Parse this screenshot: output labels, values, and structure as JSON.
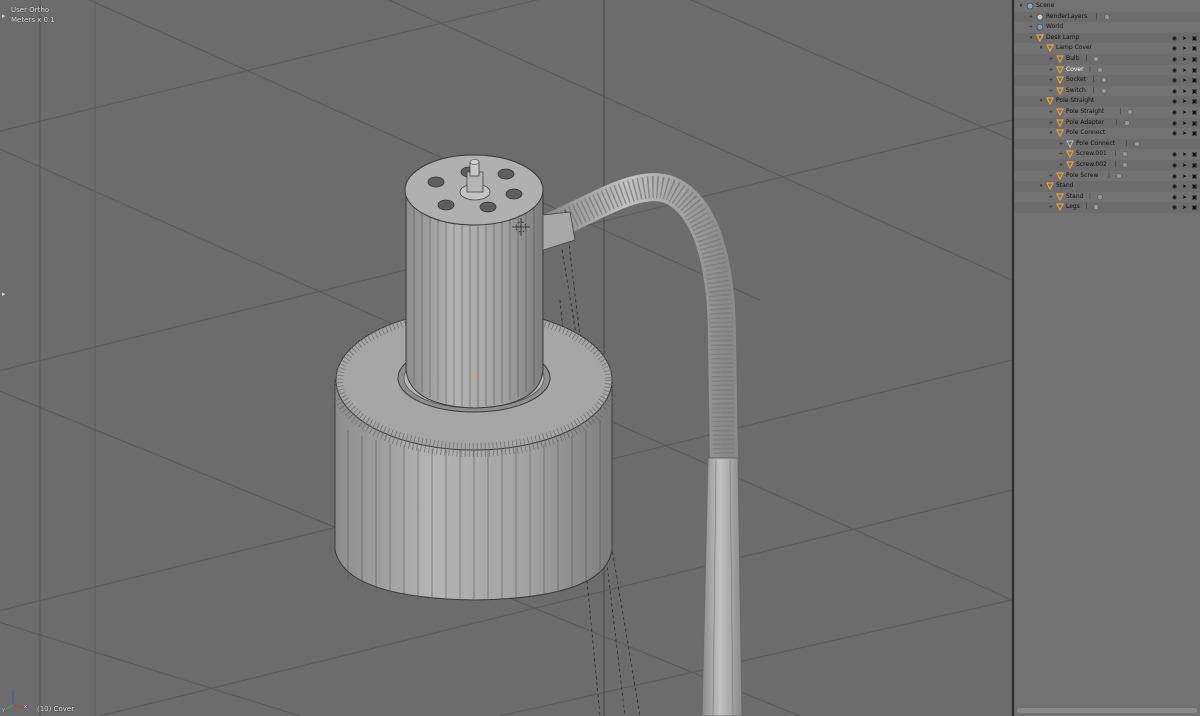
{
  "viewport": {
    "view_name": "User Ortho",
    "scale_label": "Meters x 0.1",
    "object_info": "(10) Cover",
    "axis_x_label": "x",
    "axis_y_label": "y",
    "grid_color": "#5b5b5b",
    "background_color": "#6c6c6c",
    "model_color": "#a9a9a9"
  },
  "outliner": {
    "items": [
      {
        "label": "Scene",
        "depth": 0,
        "icon": "scene-icon",
        "expanded": true,
        "restrict": false,
        "mini": false
      },
      {
        "label": "RenderLayers",
        "depth": 1,
        "icon": "renderlayers-icon",
        "expanded": false,
        "restrict": false,
        "mini": true
      },
      {
        "label": "World",
        "depth": 1,
        "icon": "world-icon",
        "expanded": false,
        "restrict": false,
        "mini": false
      },
      {
        "label": "Desk Lamp",
        "depth": 1,
        "icon": "empty-object-icon",
        "expanded": true,
        "restrict": true,
        "mini": false
      },
      {
        "label": "Lamp Cover",
        "depth": 2,
        "icon": "empty-object-icon",
        "expanded": true,
        "restrict": true,
        "mini": false
      },
      {
        "label": "Bulb",
        "depth": 3,
        "icon": "mesh-object-icon",
        "expanded": false,
        "restrict": true,
        "mini": true
      },
      {
        "label": "Cover",
        "depth": 3,
        "icon": "mesh-object-icon",
        "expanded": false,
        "restrict": true,
        "mini": true,
        "selected": true
      },
      {
        "label": "Socket",
        "depth": 3,
        "icon": "mesh-object-icon",
        "expanded": false,
        "restrict": true,
        "mini": true
      },
      {
        "label": "Switch",
        "depth": 3,
        "icon": "mesh-object-icon",
        "expanded": false,
        "restrict": true,
        "mini": true
      },
      {
        "label": "Pole Straight",
        "depth": 2,
        "icon": "empty-object-icon",
        "expanded": true,
        "restrict": true,
        "mini": false
      },
      {
        "label": "Pole Straight",
        "depth": 3,
        "icon": "mesh-object-icon",
        "expanded": false,
        "restrict": true,
        "mini": true
      },
      {
        "label": "Pole Adapter",
        "depth": 3,
        "icon": "mesh-object-icon",
        "expanded": false,
        "restrict": true,
        "mini": true
      },
      {
        "label": "Pole Connect",
        "depth": 3,
        "icon": "mesh-object-icon",
        "expanded": true,
        "restrict": true,
        "mini": false
      },
      {
        "label": "Pole Connect",
        "depth": 4,
        "icon": "mesh-data-icon",
        "expanded": false,
        "restrict": false,
        "mini": true
      },
      {
        "label": "Screw.001",
        "depth": 4,
        "icon": "mesh-object-icon",
        "expanded": false,
        "restrict": true,
        "mini": true
      },
      {
        "label": "Screw.002",
        "depth": 4,
        "icon": "mesh-object-icon",
        "expanded": false,
        "restrict": true,
        "mini": true
      },
      {
        "label": "Pole Screw",
        "depth": 3,
        "icon": "mesh-object-icon",
        "expanded": false,
        "restrict": true,
        "mini": true
      },
      {
        "label": "Stand",
        "depth": 2,
        "icon": "empty-object-icon",
        "expanded": true,
        "restrict": true,
        "mini": false
      },
      {
        "label": "Stand",
        "depth": 3,
        "icon": "mesh-object-icon",
        "expanded": false,
        "restrict": true,
        "mini": true
      },
      {
        "label": "Legs",
        "depth": 3,
        "icon": "mesh-object-icon",
        "expanded": false,
        "restrict": true,
        "mini": true
      }
    ],
    "restrict_icons": [
      "eye-icon",
      "cursor-icon",
      "camera-icon"
    ],
    "selected_text_color": "#ffffff",
    "object_icon_color": "#f0a030"
  }
}
